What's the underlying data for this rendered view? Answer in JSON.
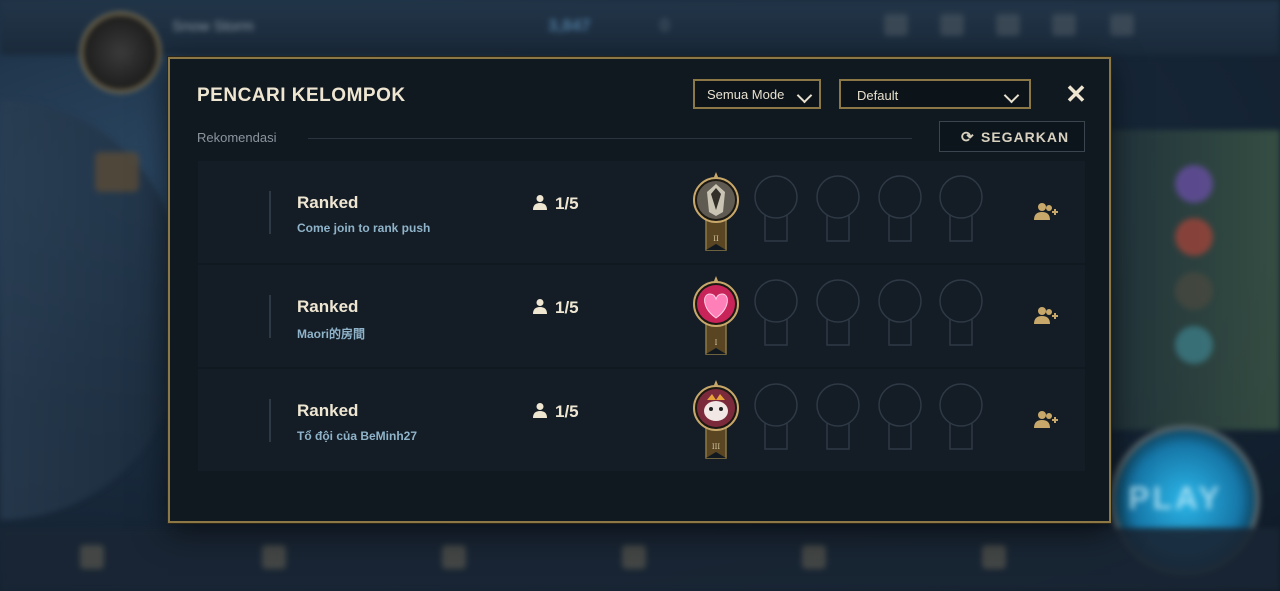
{
  "modal": {
    "title": "PENCARI KELOMPOK",
    "mode_filter": "Semua Mode",
    "sort_filter": "Default",
    "section_label": "Rekomendasi",
    "refresh_label": "SEGARKAN"
  },
  "groups": [
    {
      "mode": "Ranked",
      "description": "Come join to rank push",
      "count": "1/5",
      "rank_tier": "II",
      "avatar": "armored-knight"
    },
    {
      "mode": "Ranked",
      "description": "Maori的房間",
      "count": "1/5",
      "rank_tier": "I",
      "avatar": "pink-heart"
    },
    {
      "mode": "Ranked",
      "description": "Tổ đội của BeMinh27",
      "count": "1/5",
      "rank_tier": "III",
      "avatar": "poro-creature"
    }
  ],
  "background": {
    "play_label": "PLAY",
    "player_name": "Snow Storm",
    "currency_1": "3,847",
    "currency_2": "0"
  },
  "colors": {
    "gold_border": "#8c7846",
    "panel_bg": "#101820",
    "row_bg": "#141d26",
    "title_text": "#efe6d2",
    "desc_text": "#8fb3c9"
  }
}
